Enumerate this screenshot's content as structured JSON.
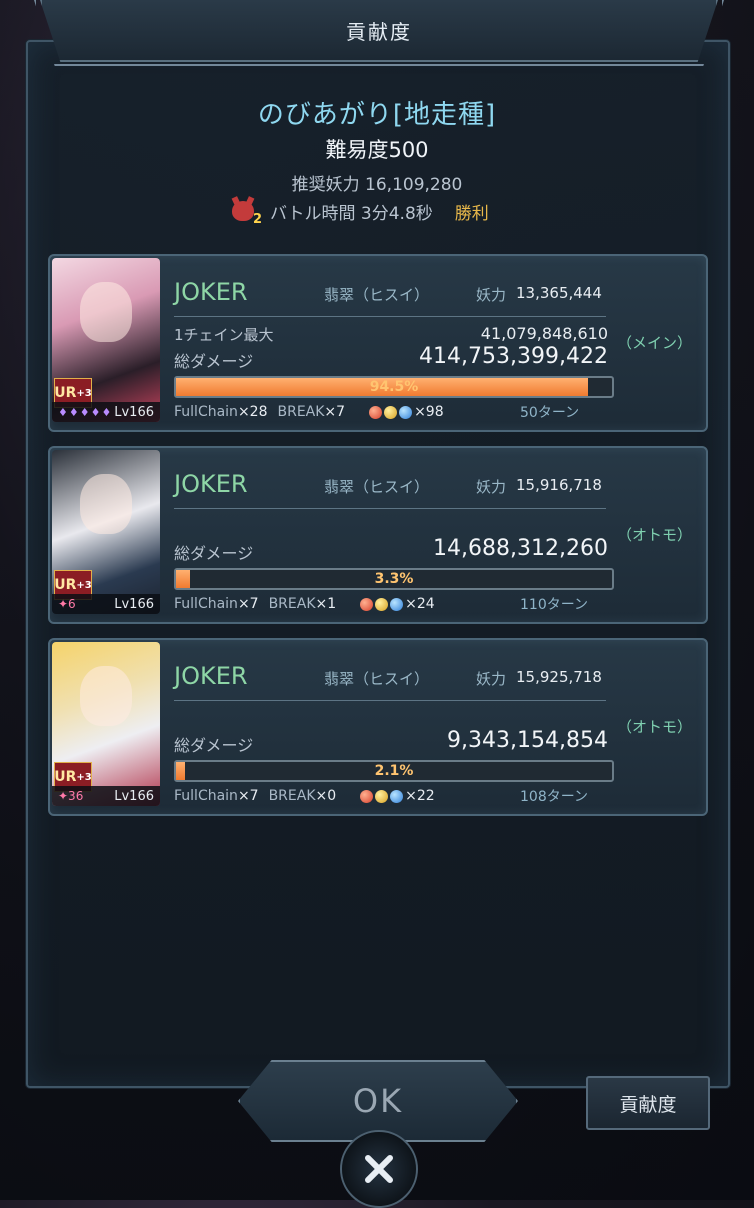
{
  "dialog": {
    "title": "貢献度"
  },
  "stage": {
    "name": "のびあがり[地走種]",
    "difficulty": "難易度500",
    "recommended_power": "推奨妖力 16,109,280",
    "demon_level": "2",
    "battle_time": "バトル時間 3分4.8秒",
    "result": "勝利"
  },
  "cards": [
    {
      "name": "JOKER",
      "attribute": "翡翠（ヒスイ）",
      "power_label": "妖力",
      "power": "13,365,444",
      "chain_label": "1チェイン最大",
      "chain_value": "41,079,848,610",
      "damage_label": "総ダメージ",
      "damage_value": "414,753,399,422",
      "percent_text": "94.5%",
      "percent": 0.945,
      "role": "（メイン）",
      "rank": "UR",
      "plus": "+3",
      "gems": "♦♦♦♦♦",
      "level": "Lv166",
      "fullchain_label": "FullChain",
      "fullchain": "×28",
      "break_label": "BREAK",
      "break": "×7",
      "orb_count": "×98",
      "turns": "50ターン"
    },
    {
      "name": "JOKER",
      "attribute": "翡翠（ヒスイ）",
      "power_label": "妖力",
      "power": "15,916,718",
      "damage_label": "総ダメージ",
      "damage_value": "14,688,312,260",
      "percent_text": "3.3%",
      "percent": 0.033,
      "role": "（オトモ）",
      "rank": "UR",
      "plus": "+3",
      "soul": "✦6",
      "level": "Lv166",
      "fullchain_label": "FullChain",
      "fullchain": "×7",
      "break_label": "BREAK",
      "break": "×1",
      "orb_count": "×24",
      "turns": "110ターン"
    },
    {
      "name": "JOKER",
      "attribute": "翡翠（ヒスイ）",
      "power_label": "妖力",
      "power": "15,925,718",
      "damage_label": "総ダメージ",
      "damage_value": "9,343,154,854",
      "percent_text": "2.1%",
      "percent": 0.021,
      "role": "（オトモ）",
      "rank": "UR",
      "plus": "+3",
      "soul": "✦36",
      "level": "Lv166",
      "fullchain_label": "FullChain",
      "fullchain": "×7",
      "break_label": "BREAK",
      "break": "×0",
      "orb_count": "×22",
      "turns": "108ターン"
    }
  ],
  "buttons": {
    "ok": "OK",
    "contribution": "貢献度"
  },
  "icons": {
    "close": "close-icon",
    "orbs": [
      "red-orb",
      "yellow-orb",
      "blue-orb"
    ]
  },
  "colors": {
    "accent": "#8fd8f0",
    "bar": "#f07a30",
    "victory": "#e8b84a",
    "name": "#8ed6a6"
  }
}
